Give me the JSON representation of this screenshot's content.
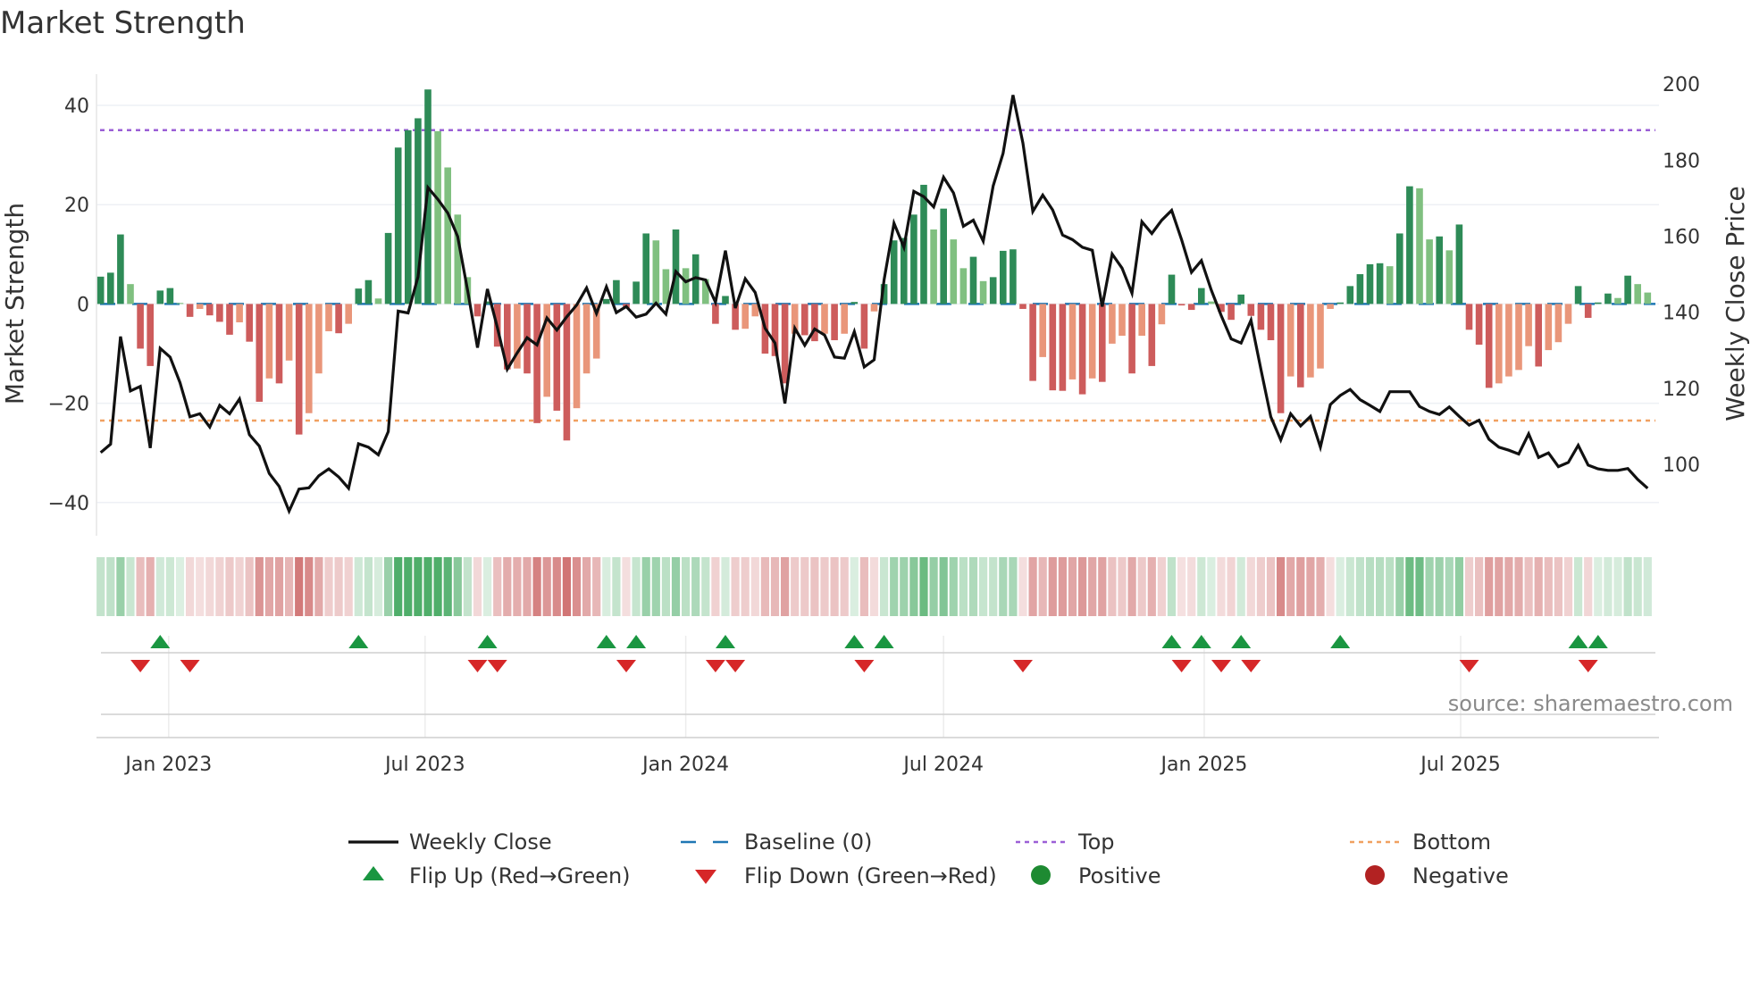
{
  "title": "Market Strength",
  "source": "source: sharemaestro.com",
  "chart_data": {
    "type": "bar",
    "title": "Market Strength",
    "ylabel": "Market Strength",
    "y2label": "Weekly Close Price",
    "ylim": [
      -48,
      46
    ],
    "y2lim": [
      88,
      200
    ],
    "x_start": "2022-11-14",
    "x_step_days": 7,
    "left_ticks": [
      {
        "v": -40,
        "label": "−40"
      },
      {
        "v": -20,
        "label": "−20"
      },
      {
        "v": 0,
        "label": "0"
      },
      {
        "v": 20,
        "label": "20"
      },
      {
        "v": 40,
        "label": "40"
      }
    ],
    "right_ticks": [
      {
        "v": 100,
        "label": "100"
      },
      {
        "v": 120,
        "label": "120"
      },
      {
        "v": 140,
        "label": "140"
      },
      {
        "v": 160,
        "label": "160"
      },
      {
        "v": 180,
        "label": "180"
      },
      {
        "v": 200,
        "label": "200"
      }
    ],
    "x_ticks": [
      {
        "date": "2023-01-01",
        "label": "Jan 2023"
      },
      {
        "date": "2023-07-01",
        "label": "Jul 2023"
      },
      {
        "date": "2024-01-01",
        "label": "Jan 2024"
      },
      {
        "date": "2024-07-01",
        "label": "Jul 2024"
      },
      {
        "date": "2025-01-01",
        "label": "Jan 2025"
      },
      {
        "date": "2025-07-01",
        "label": "Jul 2025"
      }
    ],
    "top_level": 35,
    "bottom_level": -23.5,
    "baseline": 0,
    "strength": [
      5.5,
      6.3,
      14,
      4,
      -9,
      -12.5,
      2.7,
      3.2,
      0.2,
      -2.6,
      -1,
      -2.3,
      -3.6,
      -6.2,
      -3.7,
      -7.6,
      -19.7,
      -15,
      -16,
      -11.4,
      -26.3,
      -22,
      -14,
      -5.5,
      -5.9,
      -4,
      3.1,
      4.8,
      1.1,
      14.3,
      31.5,
      35,
      37.4,
      43.2,
      34.8,
      27.5,
      18,
      5.4,
      -2.5,
      0.5,
      -8.6,
      -13.2,
      -13,
      -14,
      -24,
      -18.7,
      -21.5,
      -27.5,
      -21,
      -14,
      -11,
      1.0,
      4.8,
      -0.8,
      4.5,
      14.2,
      12.8,
      7,
      15,
      7.2,
      10,
      5,
      -4,
      1.6,
      -5.2,
      -5,
      -2.5,
      -10,
      -10.5,
      -16,
      -6,
      -6.3,
      -7.5,
      -6,
      -7.3,
      -6,
      0.4,
      -9,
      -1.5,
      4,
      12.8,
      13.3,
      18,
      24,
      15,
      19.2,
      13,
      7.2,
      9.5,
      4.6,
      5.4,
      10.7,
      11,
      -1,
      -15.5,
      -10.7,
      -17.4,
      -17.5,
      -15.2,
      -18.2,
      -15,
      -15.7,
      -8,
      -6.4,
      -14,
      -6.4,
      -12.5,
      -4.1,
      5.9,
      -0.3,
      -1.2,
      3.2,
      0.5,
      -1.6,
      -3.2,
      1.9,
      -2.4,
      -5.2,
      -7.3,
      -22,
      -14.6,
      -16.8,
      -14.8,
      -13,
      -1,
      0.3,
      3.6,
      6,
      8,
      8.2,
      7.6,
      14.2,
      23.7,
      23.3,
      13,
      13.6,
      10.8,
      16,
      -5.2,
      -8.2,
      -16.9,
      -16,
      -14.6,
      -13.3,
      -8.5,
      -12.6,
      -9.3,
      -7.7,
      -4,
      3.6,
      -2.8,
      0.3,
      2.1,
      1.2,
      5.7,
      4,
      2.3
    ],
    "weekly_close": [
      103.1,
      105.3,
      133.6,
      119.3,
      120.5,
      104.3,
      130.5,
      128.2,
      121.5,
      112.5,
      113.3,
      109.8,
      115.5,
      113.3,
      117.2,
      107.8,
      104.8,
      97.6,
      94.2,
      87.7,
      93.5,
      93.8,
      97.0,
      98.8,
      96.7,
      93.7,
      105.4,
      104.5,
      102.5,
      108.6,
      140.3,
      139.8,
      149.3,
      172.8,
      169.7,
      166.1,
      159.9,
      145.8,
      130.7,
      146.1,
      136,
      125,
      129.3,
      133.3,
      131.4,
      138.5,
      135.3,
      138.8,
      141.9,
      146.4,
      139.7,
      146.7,
      139.9,
      141.5,
      138.7,
      139.5,
      142.4,
      139.5,
      150.7,
      148,
      149.1,
      148.5,
      142.6,
      156.2,
      141.1,
      148.8,
      145.2,
      135.8,
      131.9,
      116,
      135.8,
      131.3,
      135.6,
      134,
      128.2,
      127.9,
      134.9,
      125.6,
      127.5,
      148.5,
      163.4,
      157.1,
      171.8,
      170.4,
      167.7,
      175.5,
      171.4,
      162.6,
      164.2,
      158.7,
      173.2,
      181.8,
      197.1,
      184.5,
      166.5,
      170.8,
      166.9,
      160.3,
      159.1,
      157.1,
      156.3,
      141.5,
      155.3,
      151.6,
      145,
      163.8,
      160.7,
      164.2,
      166.8,
      159.1,
      150.5,
      153.6,
      145.8,
      139.1,
      133,
      131.9,
      137.9,
      125,
      112.5,
      106.4,
      113.3,
      110.1,
      112.6,
      104.5,
      115.7,
      118.1,
      119.7,
      117,
      115.5,
      113.9,
      119.1,
      119.1,
      119.1,
      115.2,
      113.9,
      113.1,
      115.1,
      112.6,
      110.3,
      111.6,
      106.6,
      104.5,
      103.7,
      102.7,
      108,
      101.8,
      103,
      99.4,
      100.5,
      105,
      99.8,
      98.8,
      98.4,
      98.4,
      98.9,
      96,
      93.7
    ],
    "legend": [
      {
        "label": "Weekly Close",
        "symbol": "line"
      },
      {
        "label": "Baseline (0)",
        "symbol": "dashed"
      },
      {
        "label": "Top",
        "symbol": "dotted-purple"
      },
      {
        "label": "Bottom",
        "symbol": "dotted-orange"
      },
      {
        "label": "Flip Up (Red→Green)",
        "symbol": "triangle-up"
      },
      {
        "label": "Flip Down (Green→Red)",
        "symbol": "triangle-down"
      },
      {
        "label": "Positive",
        "symbol": "circle-green"
      },
      {
        "label": "Negative",
        "symbol": "circle-red"
      }
    ],
    "legend_placement": "bottom",
    "colors": {
      "up_strong": "#2e8b57",
      "up_weak": "#80c080",
      "down_strong": "#cd5c5c",
      "down_weak": "#e9967a",
      "line": "#111111",
      "baseline": "#1f77b4",
      "top": "#9b5fd6",
      "bottom": "#f0a060",
      "flip_up": "#1a9641",
      "flip_down": "#d62728",
      "positive": "#1e8a32",
      "negative": "#b22222"
    }
  }
}
